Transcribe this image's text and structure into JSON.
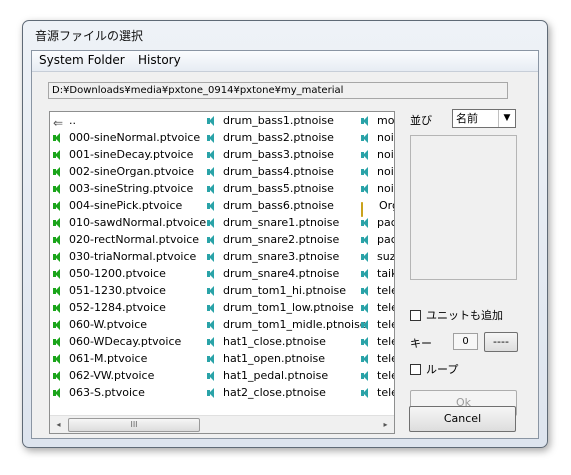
{
  "window": {
    "title": "音源ファイルの選択"
  },
  "menu": [
    {
      "label": "System Folder"
    },
    {
      "label": "History"
    }
  ],
  "path": "D:¥Downloads¥media¥pxtone_0914¥pxtone¥my_material",
  "file_columns": [
    [
      {
        "icon": "back-arrow-icon",
        "name": ".."
      },
      {
        "icon": "speaker-icon",
        "name": "000-sineNormal.ptvoice"
      },
      {
        "icon": "speaker-icon",
        "name": "001-sineDecay.ptvoice"
      },
      {
        "icon": "speaker-icon",
        "name": "002-sineOrgan.ptvoice"
      },
      {
        "icon": "speaker-icon",
        "name": "003-sineString.ptvoice"
      },
      {
        "icon": "speaker-icon",
        "name": "004-sinePick.ptvoice"
      },
      {
        "icon": "speaker-icon",
        "name": "010-sawdNormal.ptvoice"
      },
      {
        "icon": "speaker-icon",
        "name": "020-rectNormal.ptvoice"
      },
      {
        "icon": "speaker-icon",
        "name": "030-triaNormal.ptvoice"
      },
      {
        "icon": "speaker-icon",
        "name": "050-1200.ptvoice"
      },
      {
        "icon": "speaker-icon",
        "name": "051-1230.ptvoice"
      },
      {
        "icon": "speaker-icon",
        "name": "052-1284.ptvoice"
      },
      {
        "icon": "speaker-icon",
        "name": "060-W.ptvoice"
      },
      {
        "icon": "speaker-icon",
        "name": "060-WDecay.ptvoice"
      },
      {
        "icon": "speaker-icon",
        "name": "061-M.ptvoice"
      },
      {
        "icon": "speaker-icon",
        "name": "062-VW.ptvoice"
      },
      {
        "icon": "speaker-icon",
        "name": "063-S.ptvoice"
      }
    ],
    [
      {
        "icon": "noise-speaker-icon",
        "name": "drum_bass1.ptnoise"
      },
      {
        "icon": "noise-speaker-icon",
        "name": "drum_bass2.ptnoise"
      },
      {
        "icon": "noise-speaker-icon",
        "name": "drum_bass3.ptnoise"
      },
      {
        "icon": "noise-speaker-icon",
        "name": "drum_bass4.ptnoise"
      },
      {
        "icon": "noise-speaker-icon",
        "name": "drum_bass5.ptnoise"
      },
      {
        "icon": "noise-speaker-icon",
        "name": "drum_bass6.ptnoise"
      },
      {
        "icon": "noise-speaker-icon",
        "name": "drum_snare1.ptnoise"
      },
      {
        "icon": "noise-speaker-icon",
        "name": "drum_snare2.ptnoise"
      },
      {
        "icon": "noise-speaker-icon",
        "name": "drum_snare3.ptnoise"
      },
      {
        "icon": "noise-speaker-icon",
        "name": "drum_snare4.ptnoise"
      },
      {
        "icon": "noise-speaker-icon",
        "name": "drum_tom1_hi.ptnoise"
      },
      {
        "icon": "noise-speaker-icon",
        "name": "drum_tom1_low.ptnoise"
      },
      {
        "icon": "noise-speaker-icon",
        "name": "drum_tom1_midle.ptnoise"
      },
      {
        "icon": "noise-speaker-icon",
        "name": "hat1_close.ptnoise"
      },
      {
        "icon": "noise-speaker-icon",
        "name": "hat1_open.ptnoise"
      },
      {
        "icon": "noise-speaker-icon",
        "name": "hat1_pedal.ptnoise"
      },
      {
        "icon": "noise-speaker-icon",
        "name": "hat2_close.ptnoise"
      }
    ],
    [
      {
        "icon": "noise-speaker-icon",
        "name": "mo"
      },
      {
        "icon": "noise-speaker-icon",
        "name": "noi"
      },
      {
        "icon": "noise-speaker-icon",
        "name": "noi"
      },
      {
        "icon": "noise-speaker-icon",
        "name": "noi"
      },
      {
        "icon": "noise-speaker-icon",
        "name": "noi"
      },
      {
        "icon": "folder-icon",
        "name": "Org"
      },
      {
        "icon": "noise-speaker-icon",
        "name": "pac"
      },
      {
        "icon": "noise-speaker-icon",
        "name": "pac"
      },
      {
        "icon": "noise-speaker-icon",
        "name": "suz"
      },
      {
        "icon": "noise-speaker-icon",
        "name": "taik"
      },
      {
        "icon": "noise-speaker-icon",
        "name": "tele"
      },
      {
        "icon": "noise-speaker-icon",
        "name": "tele"
      },
      {
        "icon": "noise-speaker-icon",
        "name": "tele"
      },
      {
        "icon": "noise-speaker-icon",
        "name": "tele"
      },
      {
        "icon": "noise-speaker-icon",
        "name": "tele"
      },
      {
        "icon": "noise-speaker-icon",
        "name": "tele"
      },
      {
        "icon": "noise-speaker-icon",
        "name": "tele"
      }
    ]
  ],
  "scrollbar": {
    "left_arrow": "◂",
    "right_arrow": "▸",
    "grip": "III"
  },
  "sort": {
    "label": "並び",
    "selected": "名前",
    "arrow": "▼"
  },
  "options": {
    "add_unit_label": "ユニットも追加",
    "add_unit_checked": false,
    "key_label": "キー",
    "key_value": "0",
    "key_button": "----",
    "loop_label": "ループ",
    "loop_checked": false
  },
  "buttons": {
    "ok": "Ok",
    "cancel": "Cancel"
  },
  "colors": {
    "voice_icon": "#1aa51a",
    "noise_icon": "#2aa3a8"
  }
}
